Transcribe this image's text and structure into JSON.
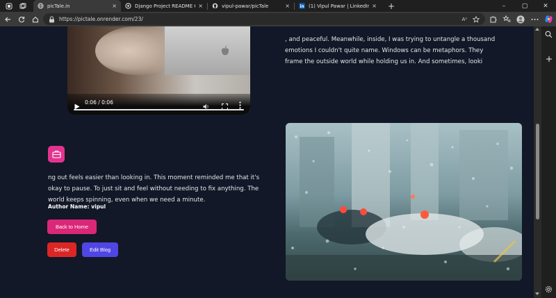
{
  "tabs": [
    {
      "label": "picTale.in",
      "active": true,
      "close": "×"
    },
    {
      "label": "Django Project README Creation",
      "active": false,
      "close": "×"
    },
    {
      "label": "vipul-pawar/picTale",
      "active": false,
      "close": "×"
    },
    {
      "label": "(1) Vipul Pawar | LinkedIn",
      "active": false,
      "close": "×"
    }
  ],
  "new_tab_label": "+",
  "window_controls": {
    "minimize": "–",
    "maximize": "▢",
    "close": "✕"
  },
  "address_bar": {
    "url": "https://pictale.onrender.com/23/",
    "read_aloud": "Aᵃ"
  },
  "video": {
    "time": "0:06 / 0:06"
  },
  "story": {
    "top_lines": [
      ", and peaceful. Meanwhile, inside, I was trying to untangle a thousand",
      "emotions I couldn't quite name. Windows can be metaphors. They",
      "frame the outside world while holding us in. And sometimes, looki"
    ],
    "mid_lines": [
      "ng out feels easier than looking in. This moment reminded me that it's",
      "okay to pause. To just sit and feel without needing to fix anything. The",
      "world keeps spinning, even when we need a minute."
    ],
    "author": "Author Name: vipul"
  },
  "buttons": {
    "back_home": "Back to Home",
    "delete": "Delete",
    "edit": "Edit Blog"
  },
  "colors": {
    "page_bg": "#121827",
    "pink": "#db2777",
    "red": "#dc2626",
    "indigo": "#4f46e5"
  }
}
